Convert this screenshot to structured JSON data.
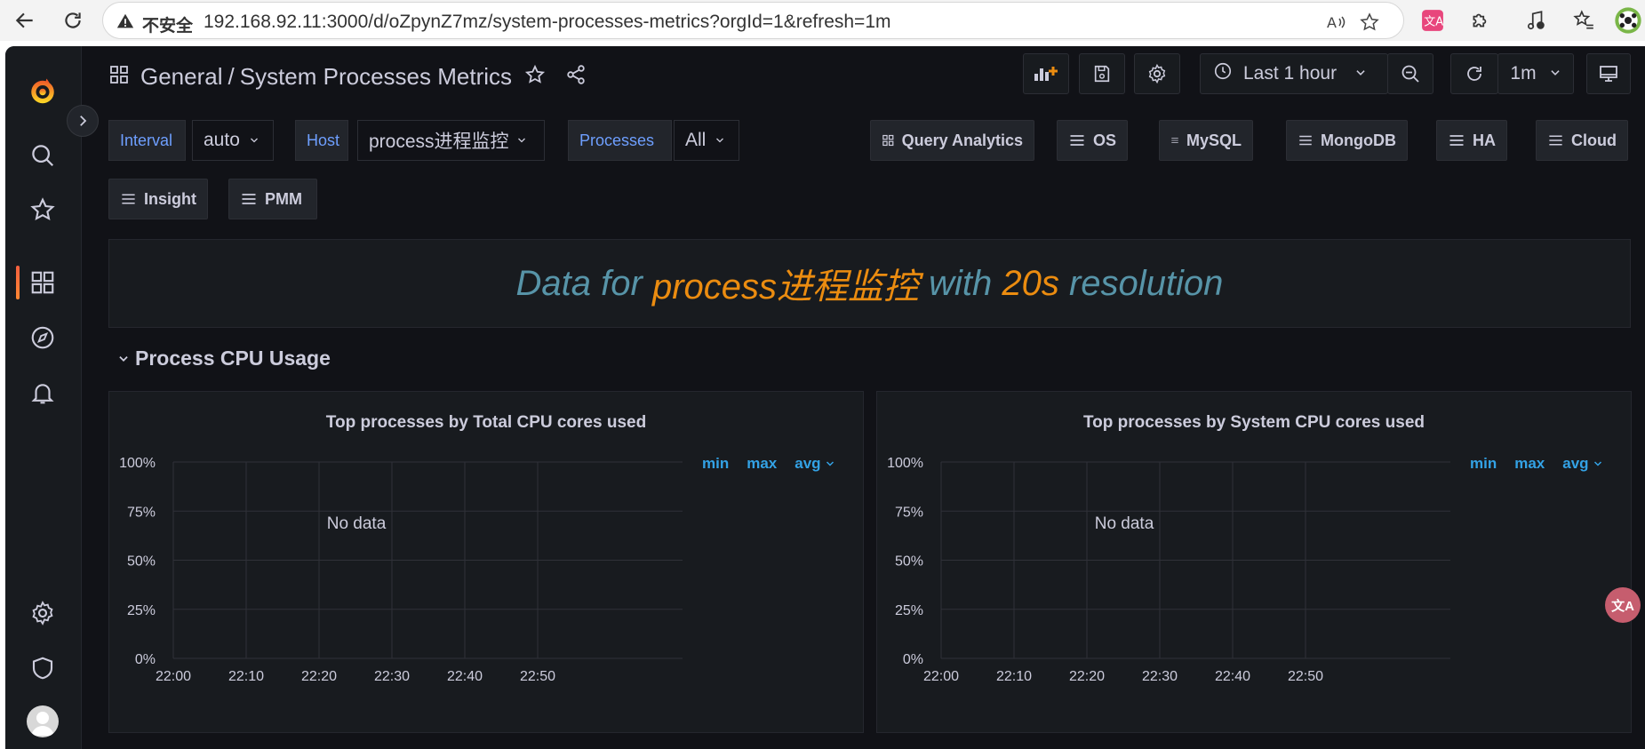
{
  "browser": {
    "security_label": "不安全",
    "url": "192.168.92.11:3000/d/oZpynZ7mz/system-processes-metrics?orgId=1&refresh=1m"
  },
  "header": {
    "breadcrumb_folder": "General",
    "breadcrumb_separator": "/",
    "dashboard_title": "System Processes Metrics",
    "time_range": "Last 1 hour",
    "refresh_interval": "1m"
  },
  "variables": [
    {
      "label": "Interval",
      "value": "auto"
    },
    {
      "label": "Host",
      "value": "process进程监控"
    },
    {
      "label": "Processes",
      "value": "All"
    }
  ],
  "dashboard_links": [
    "Query Analytics",
    "OS",
    "MySQL",
    "MongoDB",
    "HA",
    "Cloud",
    "Insight",
    "PMM"
  ],
  "banner": {
    "part1": "Data for ",
    "host": "process进程监控",
    "part2": " with ",
    "resolution": "20s",
    "part3": " resolution"
  },
  "row": {
    "title": "Process CPU Usage"
  },
  "panels": [
    {
      "title": "Top processes by Total CPU cores used",
      "no_data": "No data",
      "legend": [
        "min",
        "max",
        "avg"
      ]
    },
    {
      "title": "Top processes by System CPU cores used",
      "no_data": "No data",
      "legend": [
        "min",
        "max",
        "avg"
      ]
    }
  ],
  "chart_data": [
    {
      "type": "line",
      "title": "Top processes by Total CPU cores used",
      "x_ticks": [
        "22:00",
        "22:10",
        "22:20",
        "22:30",
        "22:40",
        "22:50"
      ],
      "y_ticks": [
        "100%",
        "75%",
        "50%",
        "25%",
        "0%"
      ],
      "ylim": [
        0,
        100
      ],
      "grid": true,
      "series": []
    },
    {
      "type": "line",
      "title": "Top processes by System CPU cores used",
      "x_ticks": [
        "22:00",
        "22:10",
        "22:20",
        "22:30",
        "22:40",
        "22:50"
      ],
      "y_ticks": [
        "100%",
        "75%",
        "50%",
        "25%",
        "0%"
      ],
      "ylim": [
        0,
        100
      ],
      "grid": true,
      "series": []
    }
  ],
  "translate_fab": "文A",
  "colors": {
    "accent": "#6e9fff",
    "orange": "#eb8c10",
    "teal": "#5794a8",
    "link": "#33a2e5"
  }
}
